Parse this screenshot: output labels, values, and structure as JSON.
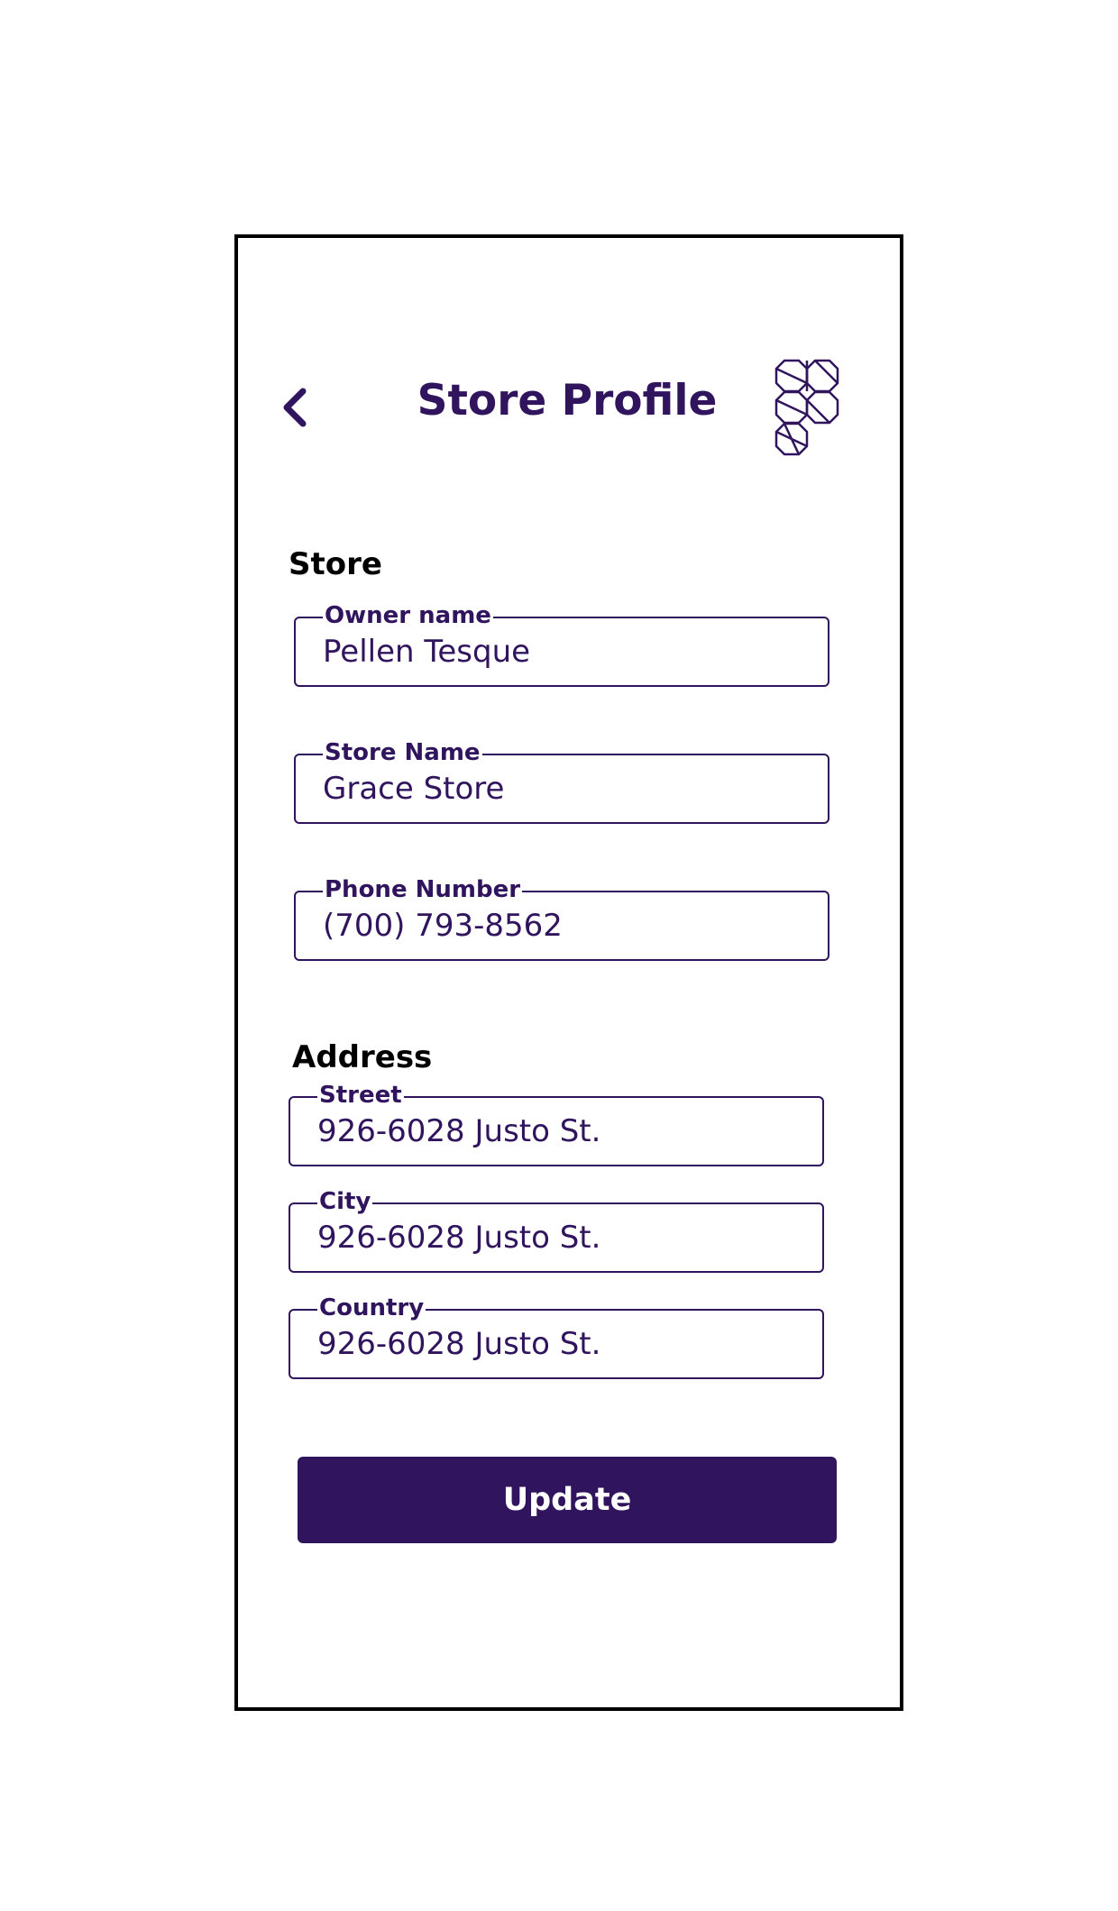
{
  "header": {
    "title": "Store Profile",
    "back_icon": "chevron-left-icon",
    "logo_icon": "figma-style-logo-icon"
  },
  "store_section": {
    "heading": "Store",
    "owner_name": {
      "label": "Owner name",
      "value": "Pellen Tesque"
    },
    "store_name": {
      "label": "Store Name",
      "value": "Grace Store"
    },
    "phone_number": {
      "label": "Phone Number",
      "value": "(700) 793-8562"
    }
  },
  "address_section": {
    "heading": "Address",
    "street": {
      "label": "Street",
      "value": "926-6028 Justo St."
    },
    "city": {
      "label": "City",
      "value": "926-6028 Justo St."
    },
    "country": {
      "label": "Country",
      "value": "926-6028 Justo St."
    }
  },
  "actions": {
    "update_label": "Update"
  },
  "colors": {
    "accent": "#30155e",
    "frame": "#000000",
    "background": "#ffffff"
  }
}
